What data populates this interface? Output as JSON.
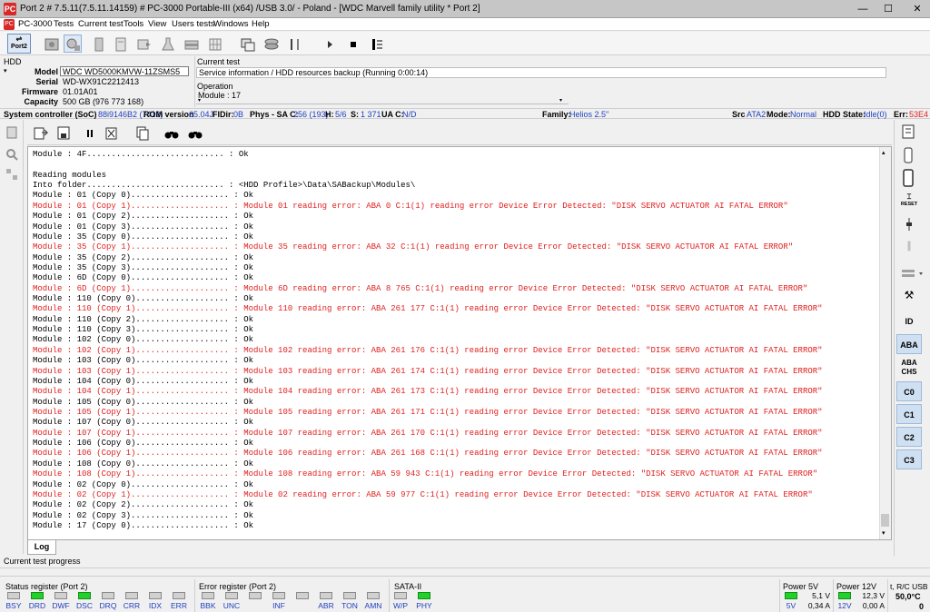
{
  "window": {
    "title": "Port 2 # 7.5.11(7.5.11.14159) # PC-3000 Portable-III (x64) /USB 3.0/ - Poland - [WDC Marvell family utility * Port 2]",
    "icon_label": "PC",
    "minimize": "—",
    "maximize": "☐",
    "close": "✕"
  },
  "menu": [
    "PC-3000",
    "Tests",
    "Current test",
    "Tools",
    "View",
    "Users tests",
    "Windows",
    "Help"
  ],
  "toolbar": {
    "port_label": "Port2"
  },
  "hdd": {
    "section_label": "HDD",
    "model_label": "Model",
    "model": "WDC WD5000KMVW-11ZSMS5",
    "serial_label": "Serial",
    "serial": "WD-WX91C2212413",
    "firmware_label": "Firmware",
    "firmware": "01.01A01",
    "capacity_label": "Capacity",
    "capacity": "500 GB (976 773 168)"
  },
  "current_test": {
    "label": "Current test",
    "value": "Service information / HDD resources backup (Running 0:00:14)",
    "operation_label": "Operation",
    "operation": "Module : 17"
  },
  "soc": {
    "soc_label": "System controller (SoC)",
    "soc_value": "88i9146B2 (7412)",
    "rom_label": "ROM version",
    "rom_value": "65.04J",
    "fidir_label": "FIDir:",
    "fidir_value": "0B",
    "phys_label": "Phys - SA C:",
    "phys_value": "256 (193)",
    "h_label": "H:",
    "h_value": "5/6",
    "s_label": "S:",
    "s_value": "1 371",
    "ua_label": "UA C:",
    "ua_value": "N/D",
    "family_label": "Family:",
    "family_value": "Helios 2.5\"",
    "src_label": "Src",
    "src_value": "ATA2",
    "mode_label": "Mode:",
    "mode_value": "Normal",
    "state_label": "HDD State:",
    "state_value": "Idle(0)",
    "err_label": "Err:",
    "err_value": "53E4"
  },
  "log": {
    "tab": "Log",
    "lines": [
      {
        "t": "Module : 4F............................ : Ok",
        "err": false
      },
      {
        "t": "",
        "err": false
      },
      {
        "t": "Reading modules",
        "err": false
      },
      {
        "t": "Into folder............................ : <HDD Profile>\\Data\\SABackup\\Modules\\",
        "err": false
      },
      {
        "t": "Module : 01 (Copy 0).................... : Ok",
        "err": false
      },
      {
        "t": "Module : 01 (Copy 1).................... : Module 01 reading error: ABA 0 C:1(1) reading error Device Error Detected: \"DISK SERVO ACTUATOR AI FATAL ERROR\"",
        "err": true
      },
      {
        "t": "Module : 01 (Copy 2).................... : Ok",
        "err": false
      },
      {
        "t": "Module : 01 (Copy 3).................... : Ok",
        "err": false
      },
      {
        "t": "Module : 35 (Copy 0).................... : Ok",
        "err": false
      },
      {
        "t": "Module : 35 (Copy 1).................... : Module 35 reading error: ABA 32 C:1(1) reading error Device Error Detected: \"DISK SERVO ACTUATOR AI FATAL ERROR\"",
        "err": true
      },
      {
        "t": "Module : 35 (Copy 2).................... : Ok",
        "err": false
      },
      {
        "t": "Module : 35 (Copy 3).................... : Ok",
        "err": false
      },
      {
        "t": "Module : 6D (Copy 0).................... : Ok",
        "err": false
      },
      {
        "t": "Module : 6D (Copy 1).................... : Module 6D reading error: ABA 8 765 C:1(1) reading error Device Error Detected: \"DISK SERVO ACTUATOR AI FATAL ERROR\"",
        "err": true
      },
      {
        "t": "Module : 110 (Copy 0)................... : Ok",
        "err": false
      },
      {
        "t": "Module : 110 (Copy 1)................... : Module 110 reading error: ABA 261 177 C:1(1) reading error Device Error Detected: \"DISK SERVO ACTUATOR AI FATAL ERROR\"",
        "err": true
      },
      {
        "t": "Module : 110 (Copy 2)................... : Ok",
        "err": false
      },
      {
        "t": "Module : 110 (Copy 3)................... : Ok",
        "err": false
      },
      {
        "t": "Module : 102 (Copy 0)................... : Ok",
        "err": false
      },
      {
        "t": "Module : 102 (Copy 1)................... : Module 102 reading error: ABA 261 176 C:1(1) reading error Device Error Detected: \"DISK SERVO ACTUATOR AI FATAL ERROR\"",
        "err": true
      },
      {
        "t": "Module : 103 (Copy 0)................... : Ok",
        "err": false
      },
      {
        "t": "Module : 103 (Copy 1)................... : Module 103 reading error: ABA 261 174 C:1(1) reading error Device Error Detected: \"DISK SERVO ACTUATOR AI FATAL ERROR\"",
        "err": true
      },
      {
        "t": "Module : 104 (Copy 0)................... : Ok",
        "err": false
      },
      {
        "t": "Module : 104 (Copy 1)................... : Module 104 reading error: ABA 261 173 C:1(1) reading error Device Error Detected: \"DISK SERVO ACTUATOR AI FATAL ERROR\"",
        "err": true
      },
      {
        "t": "Module : 105 (Copy 0)................... : Ok",
        "err": false
      },
      {
        "t": "Module : 105 (Copy 1)................... : Module 105 reading error: ABA 261 171 C:1(1) reading error Device Error Detected: \"DISK SERVO ACTUATOR AI FATAL ERROR\"",
        "err": true
      },
      {
        "t": "Module : 107 (Copy 0)................... : Ok",
        "err": false
      },
      {
        "t": "Module : 107 (Copy 1)................... : Module 107 reading error: ABA 261 170 C:1(1) reading error Device Error Detected: \"DISK SERVO ACTUATOR AI FATAL ERROR\"",
        "err": true
      },
      {
        "t": "Module : 106 (Copy 0)................... : Ok",
        "err": false
      },
      {
        "t": "Module : 106 (Copy 1)................... : Module 106 reading error: ABA 261 168 C:1(1) reading error Device Error Detected: \"DISK SERVO ACTUATOR AI FATAL ERROR\"",
        "err": true
      },
      {
        "t": "Module : 108 (Copy 0)................... : Ok",
        "err": false
      },
      {
        "t": "Module : 108 (Copy 1)................... : Module 108 reading error: ABA 59 943 C:1(1) reading error Device Error Detected: \"DISK SERVO ACTUATOR AI FATAL ERROR\"",
        "err": true
      },
      {
        "t": "Module : 02 (Copy 0).................... : Ok",
        "err": false
      },
      {
        "t": "Module : 02 (Copy 1).................... : Module 02 reading error: ABA 59 977 C:1(1) reading error Device Error Detected: \"DISK SERVO ACTUATOR AI FATAL ERROR\"",
        "err": true
      },
      {
        "t": "Module : 02 (Copy 2).................... : Ok",
        "err": false
      },
      {
        "t": "Module : 02 (Copy 3).................... : Ok",
        "err": false
      },
      {
        "t": "Module : 17 (Copy 0).................... : Ok",
        "err": false
      }
    ]
  },
  "right_sidebar": {
    "id": "ID",
    "aba": "ABA",
    "aba_chs": "ABA CHS",
    "c0": "C0",
    "c1": "C1",
    "c2": "C2",
    "c3": "C3",
    "reset": "RESET"
  },
  "bottom": {
    "progress_label": "Current test progress",
    "status_title": "Status register (Port 2)",
    "status_leds": [
      {
        "label": "BSY",
        "on": false
      },
      {
        "label": "DRD",
        "on": true
      },
      {
        "label": "DWF",
        "on": false
      },
      {
        "label": "DSC",
        "on": true
      },
      {
        "label": "DRQ",
        "on": false
      },
      {
        "label": "CRR",
        "on": false
      },
      {
        "label": "IDX",
        "on": false
      },
      {
        "label": "ERR",
        "on": false
      }
    ],
    "error_title": "Error register (Port 2)",
    "error_leds": [
      {
        "label": "BBK",
        "on": false
      },
      {
        "label": "UNC",
        "on": false
      },
      {
        "label": "",
        "on": false
      },
      {
        "label": "INF",
        "on": false
      },
      {
        "label": "",
        "on": false
      },
      {
        "label": "ABR",
        "on": false
      },
      {
        "label": "TON",
        "on": false
      },
      {
        "label": "AMN",
        "on": false
      }
    ],
    "sata_title": "SATA-II",
    "sata_leds": [
      {
        "label": "W/P",
        "on": false
      },
      {
        "label": "PHY",
        "on": true
      }
    ],
    "power5_title": "Power 5V",
    "power5_label": "5V",
    "power5_v": "5,1 V",
    "power5_a": "0,34 A",
    "power12_title": "Power 12V",
    "power12_label": "12V",
    "power12_v": "12,3 V",
    "power12_a": "0,00 A",
    "usb_title": "t, R/C USB",
    "usb_temp": "50,0°C",
    "usb_count": "0"
  },
  "colors": {
    "error_text": "#e0201f",
    "led_on": "#22d02a",
    "value_blue": "#1f3fbf"
  }
}
